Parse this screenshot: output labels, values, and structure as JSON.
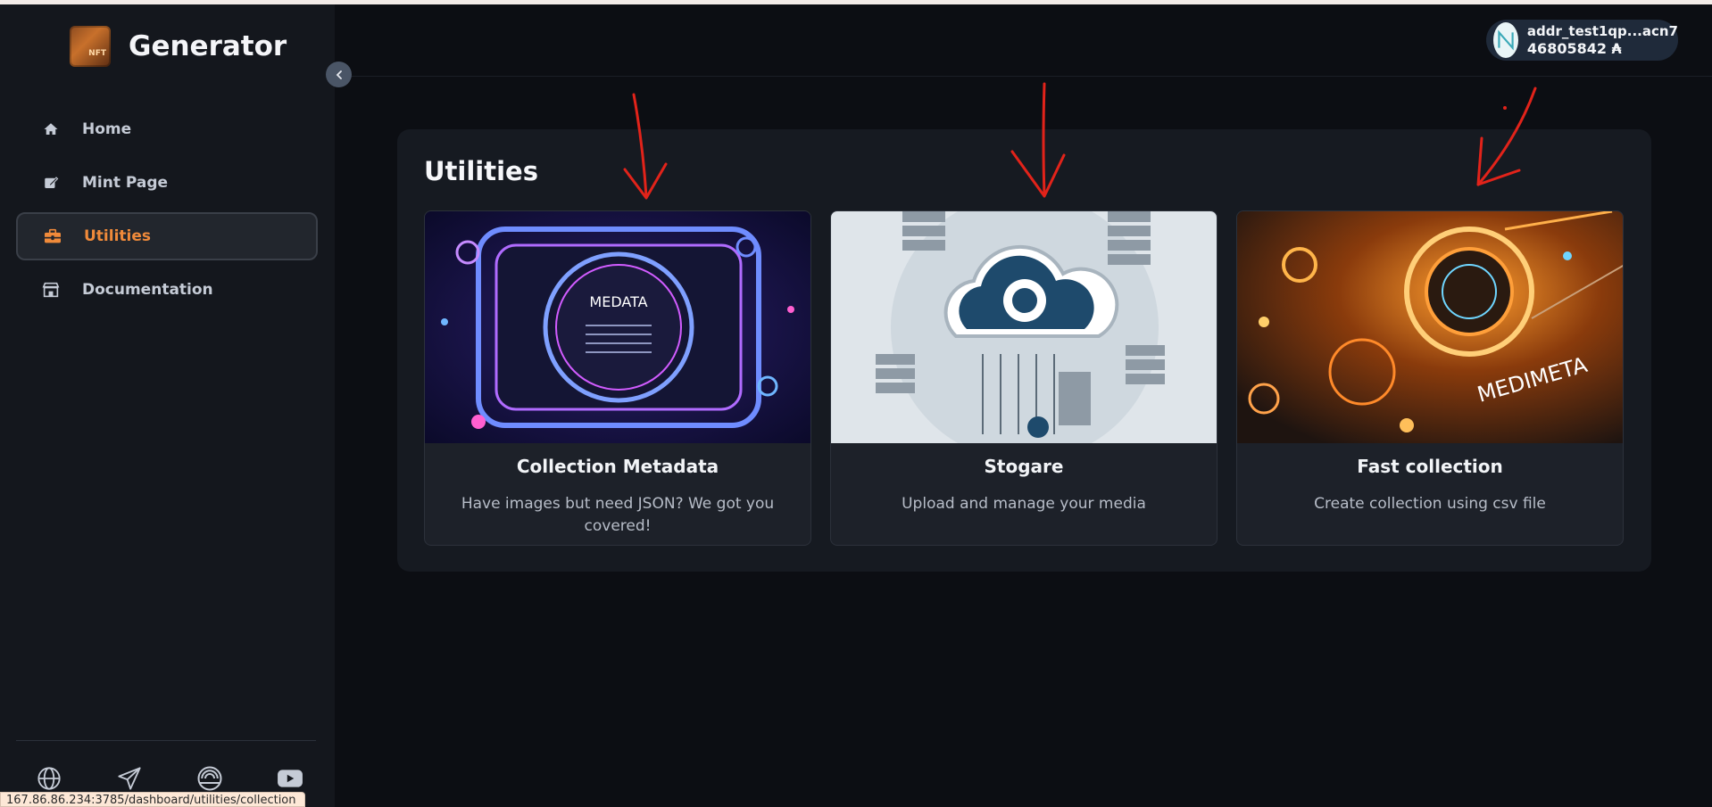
{
  "app": {
    "title": "Generator",
    "logo_text": "NFT"
  },
  "sidebar": {
    "items": [
      {
        "label": "Home",
        "icon": "home-icon",
        "active": false
      },
      {
        "label": "Mint Page",
        "icon": "edit-icon",
        "active": false
      },
      {
        "label": "Utilities",
        "icon": "toolbox-icon",
        "active": true
      },
      {
        "label": "Documentation",
        "icon": "store-icon",
        "active": false
      }
    ],
    "social_icons": [
      "globe-icon",
      "send-icon",
      "signal-icon",
      "youtube-icon"
    ]
  },
  "wallet": {
    "address": "addr_test1qp...acn7",
    "balance": "46805842 ₳"
  },
  "main": {
    "title": "Utilities",
    "cards": [
      {
        "title": "Collection Metadata",
        "description": "Have images but need JSON? We got you covered!",
        "image_text": "MEDATA"
      },
      {
        "title": "Stogare",
        "description": "Upload and manage your media"
      },
      {
        "title": "Fast collection",
        "description": "Create collection using csv file",
        "image_text": "MEDIMETA"
      }
    ]
  },
  "status_bar": {
    "url": "167.86.86.234:3785/dashboard/utilities/collection"
  },
  "colors": {
    "accent": "#f08a3a",
    "annotation": "#e2231a",
    "background": "#0c0e13",
    "panel": "#161a21"
  }
}
